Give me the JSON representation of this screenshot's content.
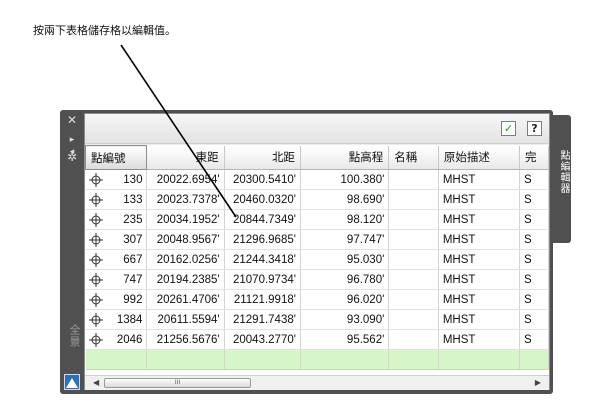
{
  "instruction": "按兩下表格儲存格以編輯值。",
  "palette": {
    "vertical_title": "全景",
    "tab_label": "點編輯器"
  },
  "side_icons": [
    "close-icon",
    "minimize-icon",
    "gear-icon",
    "autocad-logo-icon"
  ],
  "toolbar": {
    "check_label": "✓",
    "help_label": "?"
  },
  "table": {
    "columns": [
      "點編號",
      "東距",
      "北距",
      "點高程",
      "名稱",
      "原始描述",
      "完"
    ],
    "rows": [
      [
        "130",
        "20022.6954'",
        "20300.5410'",
        "100.380'",
        "",
        "MHST",
        "S"
      ],
      [
        "133",
        "20023.7378'",
        "20460.0320'",
        "98.690'",
        "",
        "MHST",
        "S"
      ],
      [
        "235",
        "20034.1952'",
        "20844.7349'",
        "98.120'",
        "",
        "MHST",
        "S"
      ],
      [
        "307",
        "20048.9567'",
        "21296.9685'",
        "97.747'",
        "",
        "MHST",
        "S"
      ],
      [
        "667",
        "20162.0256'",
        "21244.3418'",
        "95.030'",
        "",
        "MHST",
        "S"
      ],
      [
        "747",
        "20194.2385'",
        "21070.9734'",
        "96.780'",
        "",
        "MHST",
        "S"
      ],
      [
        "992",
        "20261.4706'",
        "21121.9918'",
        "96.020'",
        "",
        "MHST",
        "S"
      ],
      [
        "1384",
        "20611.5594'",
        "21291.7438'",
        "93.090'",
        "",
        "MHST",
        "S"
      ],
      [
        "2046",
        "21256.5676'",
        "20043.2770'",
        "95.562'",
        "",
        "MHST",
        "S"
      ]
    ]
  },
  "scrollbar": {
    "thumb_label": "III"
  },
  "colors": {
    "new_row": "#d6f5c9",
    "palette_bg": "#505050",
    "check": "#1e9a1e"
  }
}
